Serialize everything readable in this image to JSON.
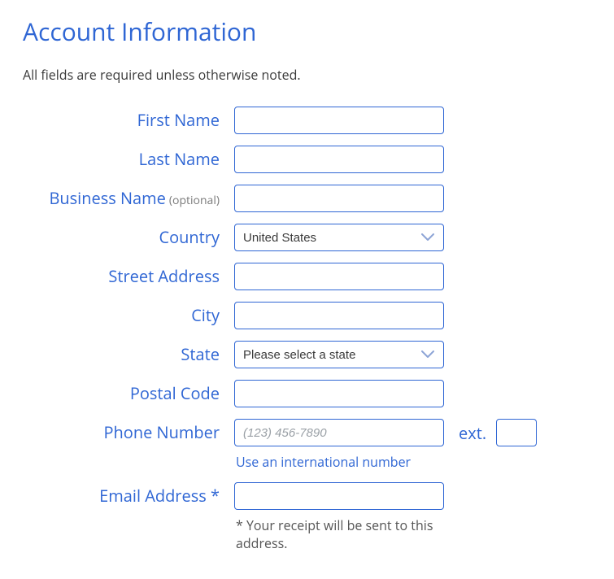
{
  "title": "Account Information",
  "required_note": "All fields are required unless otherwise noted.",
  "labels": {
    "first_name": "First Name",
    "last_name": "Last Name",
    "business_name": "Business Name",
    "optional": "(optional)",
    "country": "Country",
    "street_address": "Street Address",
    "city": "City",
    "state": "State",
    "postal_code": "Postal Code",
    "phone_number": "Phone Number",
    "ext": "ext.",
    "email_address": "Email Address *"
  },
  "values": {
    "first_name": "",
    "last_name": "",
    "business_name": "",
    "country": "United States",
    "street_address": "",
    "city": "",
    "state": "Please select a state",
    "postal_code": "",
    "phone_number": "",
    "ext": "",
    "email_address": ""
  },
  "placeholders": {
    "phone_number": "(123) 456-7890"
  },
  "links": {
    "intl_number": "Use an international number"
  },
  "notes": {
    "email": "* Your receipt will be sent to this address."
  }
}
